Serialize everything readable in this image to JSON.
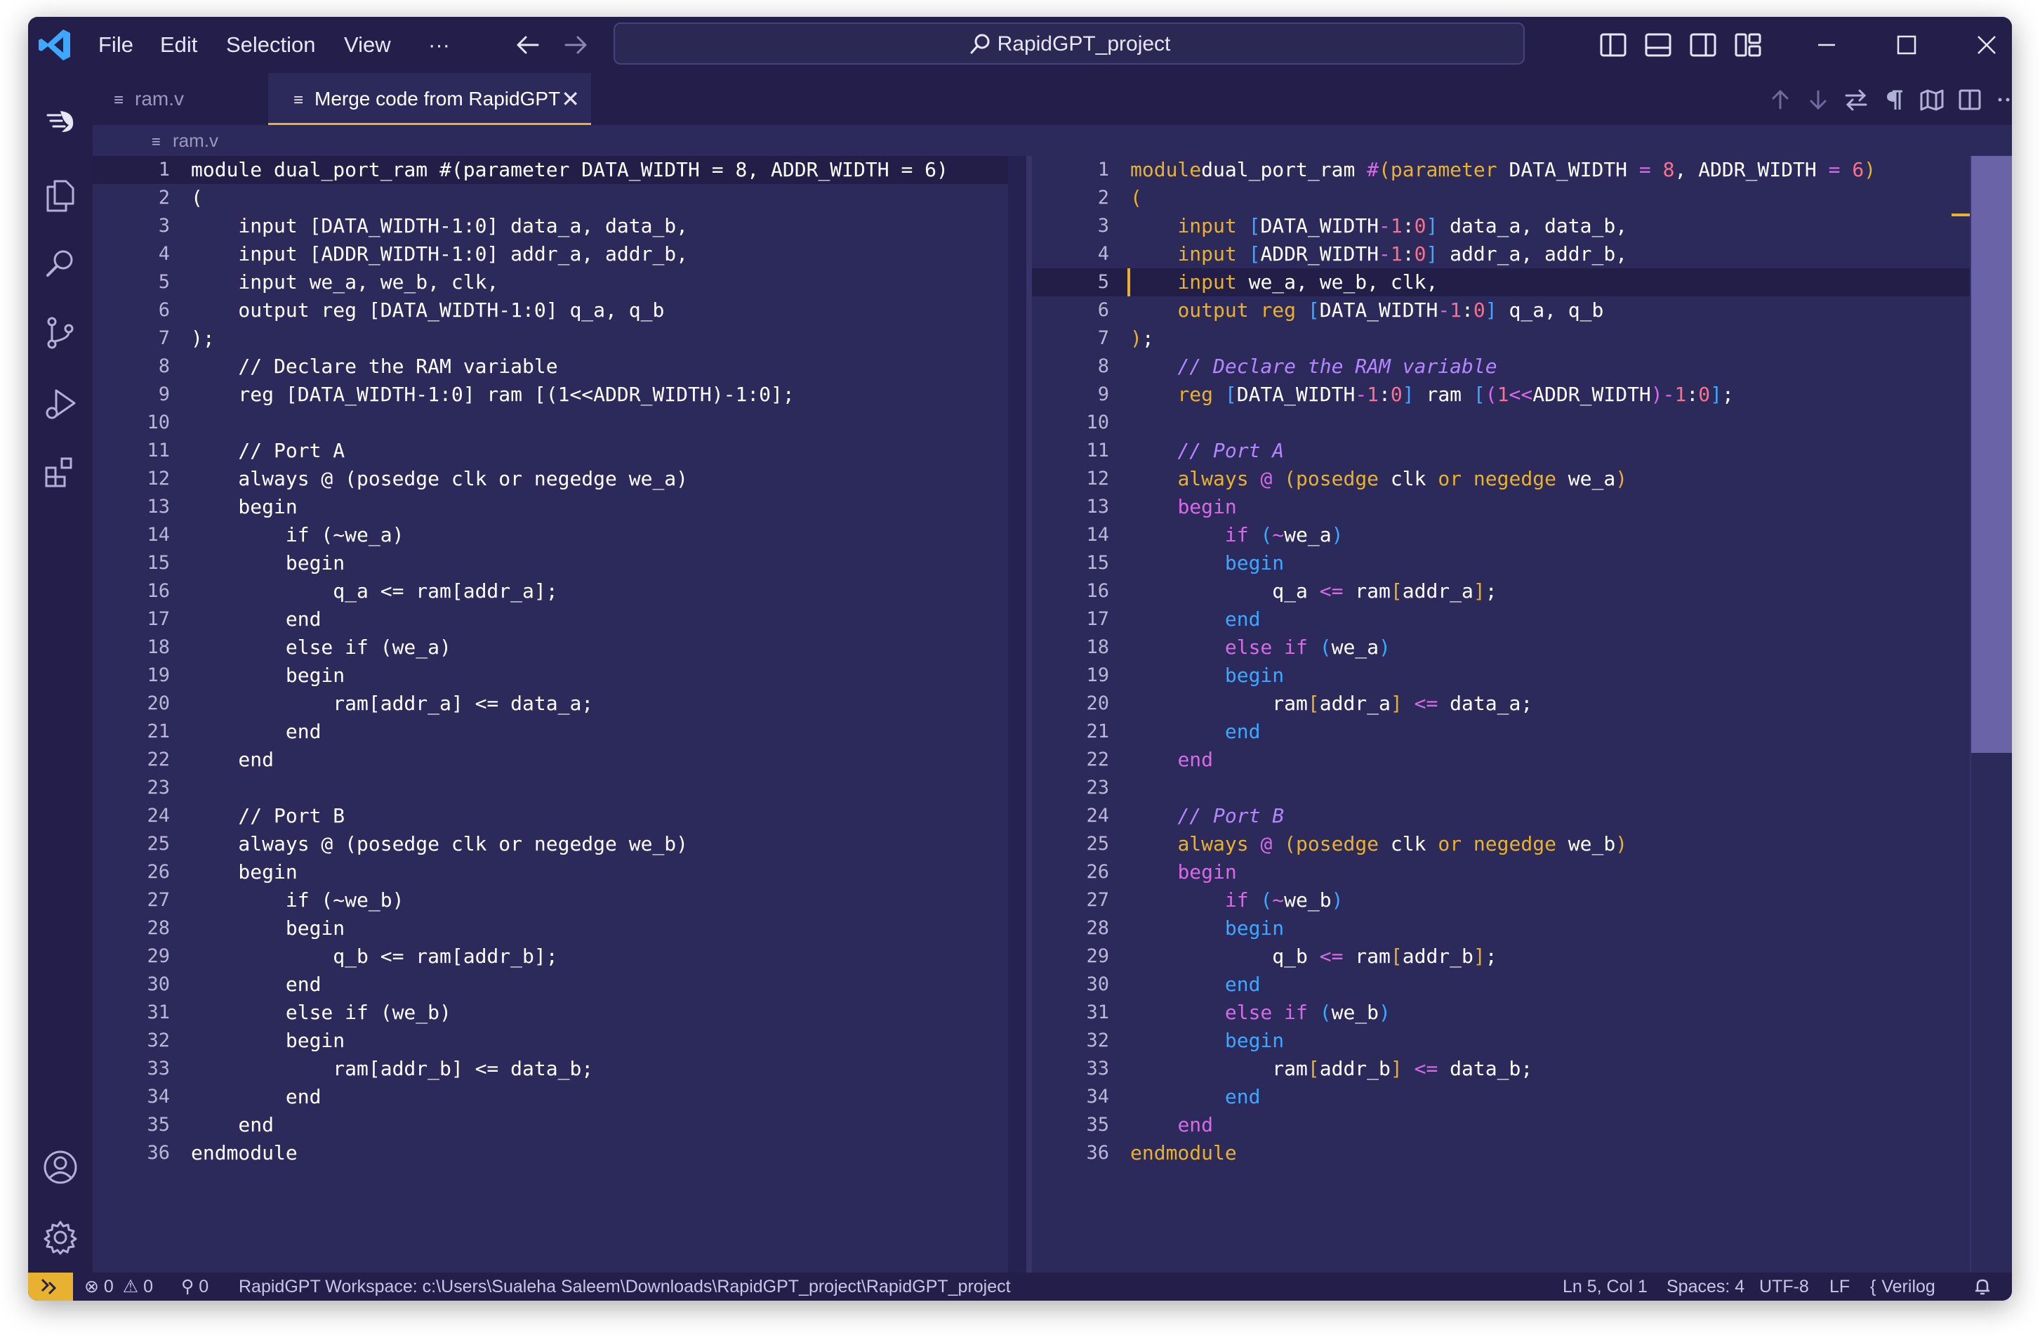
{
  "titlebar": {
    "menus": [
      "File",
      "Edit",
      "Selection",
      "View",
      "···"
    ],
    "search_text": "RapidGPT_project"
  },
  "tabs": [
    {
      "label": "ram.v",
      "active": false
    },
    {
      "label": "Merge code from RapidGPT",
      "active": true,
      "close": "✕"
    }
  ],
  "breadcrumb": "ram.v",
  "colors": {
    "background": "#2c2a5a",
    "chrome": "#231f4a",
    "accent": "#e8b230",
    "keyword": "#e8b230",
    "control": "#3ea7ff",
    "block": "#d66be6",
    "number": "#ff6f8b",
    "comment": "#b486ff"
  },
  "icons": {
    "titlebar": [
      "vscode-logo-icon",
      "arrow-left-icon",
      "arrow-right-icon",
      "search-icon",
      "toggle-primary-sidebar-icon",
      "toggle-panel-icon",
      "toggle-secondary-sidebar-icon",
      "customize-layout-icon",
      "minimize-icon",
      "maximize-icon",
      "close-icon"
    ],
    "activity": [
      "rapidgpt-icon",
      "explorer-icon",
      "search-icon",
      "source-control-icon",
      "run-debug-icon",
      "extensions-icon",
      "account-icon",
      "settings-gear-icon"
    ],
    "editor_actions": [
      "previous-change-icon",
      "next-change-icon",
      "swap-icon",
      "whitespace-icon",
      "minimap-icon",
      "split-editor-icon",
      "more-actions-icon"
    ]
  },
  "left_code": [
    "module dual_port_ram #(parameter DATA_WIDTH = 8, ADDR_WIDTH = 6)",
    "(",
    "    input [DATA_WIDTH-1:0] data_a, data_b,",
    "    input [ADDR_WIDTH-1:0] addr_a, addr_b,",
    "    input we_a, we_b, clk,",
    "    output reg [DATA_WIDTH-1:0] q_a, q_b",
    ");",
    "    // Declare the RAM variable",
    "    reg [DATA_WIDTH-1:0] ram [(1<<ADDR_WIDTH)-1:0];",
    "",
    "    // Port A",
    "    always @ (posedge clk or negedge we_a)",
    "    begin",
    "        if (~we_a)",
    "        begin",
    "            q_a <= ram[addr_a];",
    "        end",
    "        else if (we_a)",
    "        begin",
    "            ram[addr_a] <= data_a;",
    "        end",
    "    end",
    "",
    "    // Port B",
    "    always @ (posedge clk or negedge we_b)",
    "    begin",
    "        if (~we_b)",
    "        begin",
    "            q_b <= ram[addr_b];",
    "        end",
    "        else if (we_b)",
    "        begin",
    "            ram[addr_b] <= data_b;",
    "        end",
    "    end",
    "endmodule"
  ],
  "right_code": [
    [
      [
        "kw",
        "module"
      ],
      [
        "",
        "dual_port_ram "
      ],
      [
        "op",
        "#"
      ],
      [
        "br",
        "("
      ],
      [
        "kw",
        "parameter"
      ],
      [
        "",
        " DATA_WIDTH "
      ],
      [
        "op",
        "="
      ],
      [
        "",
        " "
      ],
      [
        "num",
        "8"
      ],
      [
        "",
        ", ADDR_WIDTH "
      ],
      [
        "op",
        "="
      ],
      [
        "",
        " "
      ],
      [
        "num",
        "6"
      ],
      [
        "br",
        ")"
      ]
    ],
    [
      [
        "br",
        "("
      ]
    ],
    [
      [
        "",
        "    "
      ],
      [
        "kw",
        "input"
      ],
      [
        "",
        " "
      ],
      [
        "ctl",
        "["
      ],
      [
        "",
        "DATA_WIDTH"
      ],
      [
        "op",
        "-"
      ],
      [
        "num",
        "1"
      ],
      [
        "",
        ":"
      ],
      [
        "num",
        "0"
      ],
      [
        "ctl",
        "]"
      ],
      [
        "",
        " data_a, data_b,"
      ]
    ],
    [
      [
        "",
        "    "
      ],
      [
        "kw",
        "input"
      ],
      [
        "",
        " "
      ],
      [
        "ctl",
        "["
      ],
      [
        "",
        "ADDR_WIDTH"
      ],
      [
        "op",
        "-"
      ],
      [
        "num",
        "1"
      ],
      [
        "",
        ":"
      ],
      [
        "num",
        "0"
      ],
      [
        "ctl",
        "]"
      ],
      [
        "",
        " addr_a, addr_b,"
      ]
    ],
    [
      [
        "",
        "    "
      ],
      [
        "kw",
        "input"
      ],
      [
        "",
        " we_a, we_b, clk,"
      ]
    ],
    [
      [
        "",
        "    "
      ],
      [
        "kw",
        "output"
      ],
      [
        "",
        " "
      ],
      [
        "kw",
        "reg"
      ],
      [
        "",
        " "
      ],
      [
        "ctl",
        "["
      ],
      [
        "",
        "DATA_WIDTH"
      ],
      [
        "op",
        "-"
      ],
      [
        "num",
        "1"
      ],
      [
        "",
        ":"
      ],
      [
        "num",
        "0"
      ],
      [
        "ctl",
        "]"
      ],
      [
        "",
        " q_a, q_b"
      ]
    ],
    [
      [
        "br",
        ")"
      ],
      [
        "",
        ";"
      ]
    ],
    [
      [
        "",
        "    "
      ],
      [
        "cm",
        "// Declare the RAM variable"
      ]
    ],
    [
      [
        "",
        "    "
      ],
      [
        "kw",
        "reg"
      ],
      [
        "",
        " "
      ],
      [
        "ctl",
        "["
      ],
      [
        "",
        "DATA_WIDTH"
      ],
      [
        "op",
        "-"
      ],
      [
        "num",
        "1"
      ],
      [
        "",
        ":"
      ],
      [
        "num",
        "0"
      ],
      [
        "ctl",
        "]"
      ],
      [
        "",
        " ram "
      ],
      [
        "ctl",
        "["
      ],
      [
        "blk",
        "("
      ],
      [
        "num",
        "1"
      ],
      [
        "op",
        "<<"
      ],
      [
        "",
        "ADDR_WIDTH"
      ],
      [
        "blk",
        ")"
      ],
      [
        "op",
        "-"
      ],
      [
        "num",
        "1"
      ],
      [
        "",
        ":"
      ],
      [
        "num",
        "0"
      ],
      [
        "ctl",
        "]"
      ],
      [
        "",
        ";"
      ]
    ],
    [],
    [
      [
        "",
        "    "
      ],
      [
        "cm",
        "// Port A"
      ]
    ],
    [
      [
        "",
        "    "
      ],
      [
        "kw",
        "always"
      ],
      [
        "",
        " "
      ],
      [
        "op",
        "@"
      ],
      [
        "",
        " "
      ],
      [
        "br",
        "("
      ],
      [
        "kw",
        "posedge"
      ],
      [
        "",
        " clk "
      ],
      [
        "kw",
        "or"
      ],
      [
        "",
        " "
      ],
      [
        "kw",
        "negedge"
      ],
      [
        "",
        " we_a"
      ],
      [
        "br",
        ")"
      ]
    ],
    [
      [
        "",
        "    "
      ],
      [
        "blk",
        "begin"
      ]
    ],
    [
      [
        "",
        "        "
      ],
      [
        "blk",
        "if"
      ],
      [
        "",
        " "
      ],
      [
        "ctl",
        "("
      ],
      [
        "op",
        "~"
      ],
      [
        "",
        "we_a"
      ],
      [
        "ctl",
        ")"
      ]
    ],
    [
      [
        "",
        "        "
      ],
      [
        "ctl",
        "begin"
      ]
    ],
    [
      [
        "",
        "            q_a "
      ],
      [
        "op",
        "<="
      ],
      [
        "",
        " ram"
      ],
      [
        "br",
        "["
      ],
      [
        "",
        "addr_a"
      ],
      [
        "br",
        "]"
      ],
      [
        "",
        ";"
      ]
    ],
    [
      [
        "",
        "        "
      ],
      [
        "ctl",
        "end"
      ]
    ],
    [
      [
        "",
        "        "
      ],
      [
        "blk",
        "else"
      ],
      [
        "",
        " "
      ],
      [
        "blk",
        "if"
      ],
      [
        "",
        " "
      ],
      [
        "ctl",
        "("
      ],
      [
        "",
        "we_a"
      ],
      [
        "ctl",
        ")"
      ]
    ],
    [
      [
        "",
        "        "
      ],
      [
        "ctl",
        "begin"
      ]
    ],
    [
      [
        "",
        "            ram"
      ],
      [
        "br",
        "["
      ],
      [
        "",
        "addr_a"
      ],
      [
        "br",
        "]"
      ],
      [
        "",
        " "
      ],
      [
        "op",
        "<="
      ],
      [
        "",
        " data_a;"
      ]
    ],
    [
      [
        "",
        "        "
      ],
      [
        "ctl",
        "end"
      ]
    ],
    [
      [
        "",
        "    "
      ],
      [
        "blk",
        "end"
      ]
    ],
    [],
    [
      [
        "",
        "    "
      ],
      [
        "cm",
        "// Port B"
      ]
    ],
    [
      [
        "",
        "    "
      ],
      [
        "kw",
        "always"
      ],
      [
        "",
        " "
      ],
      [
        "op",
        "@"
      ],
      [
        "",
        " "
      ],
      [
        "br",
        "("
      ],
      [
        "kw",
        "posedge"
      ],
      [
        "",
        " clk "
      ],
      [
        "kw",
        "or"
      ],
      [
        "",
        " "
      ],
      [
        "kw",
        "negedge"
      ],
      [
        "",
        " we_b"
      ],
      [
        "br",
        ")"
      ]
    ],
    [
      [
        "",
        "    "
      ],
      [
        "blk",
        "begin"
      ]
    ],
    [
      [
        "",
        "        "
      ],
      [
        "blk",
        "if"
      ],
      [
        "",
        " "
      ],
      [
        "ctl",
        "("
      ],
      [
        "op",
        "~"
      ],
      [
        "",
        "we_b"
      ],
      [
        "ctl",
        ")"
      ]
    ],
    [
      [
        "",
        "        "
      ],
      [
        "ctl",
        "begin"
      ]
    ],
    [
      [
        "",
        "            q_b "
      ],
      [
        "op",
        "<="
      ],
      [
        "",
        " ram"
      ],
      [
        "br",
        "["
      ],
      [
        "",
        "addr_b"
      ],
      [
        "br",
        "]"
      ],
      [
        "",
        ";"
      ]
    ],
    [
      [
        "",
        "        "
      ],
      [
        "ctl",
        "end"
      ]
    ],
    [
      [
        "",
        "        "
      ],
      [
        "blk",
        "else"
      ],
      [
        "",
        " "
      ],
      [
        "blk",
        "if"
      ],
      [
        "",
        " "
      ],
      [
        "ctl",
        "("
      ],
      [
        "",
        "we_b"
      ],
      [
        "ctl",
        ")"
      ]
    ],
    [
      [
        "",
        "        "
      ],
      [
        "ctl",
        "begin"
      ]
    ],
    [
      [
        "",
        "            ram"
      ],
      [
        "br",
        "["
      ],
      [
        "",
        "addr_b"
      ],
      [
        "br",
        "]"
      ],
      [
        "",
        " "
      ],
      [
        "op",
        "<="
      ],
      [
        "",
        " data_b;"
      ]
    ],
    [
      [
        "",
        "        "
      ],
      [
        "ctl",
        "end"
      ]
    ],
    [
      [
        "",
        "    "
      ],
      [
        "blk",
        "end"
      ]
    ],
    [
      [
        "kw",
        "endmodule"
      ]
    ]
  ],
  "status": {
    "errors": "0",
    "warnings": "0",
    "ports": "0",
    "workspace": "RapidGPT Workspace: c:\\Users\\Sualeha Saleem\\Downloads\\RapidGPT_project\\RapidGPT_project",
    "position": "Ln 5, Col 1",
    "spaces": "Spaces: 4",
    "encoding": "UTF-8",
    "eol": "LF",
    "language": "Verilog"
  }
}
